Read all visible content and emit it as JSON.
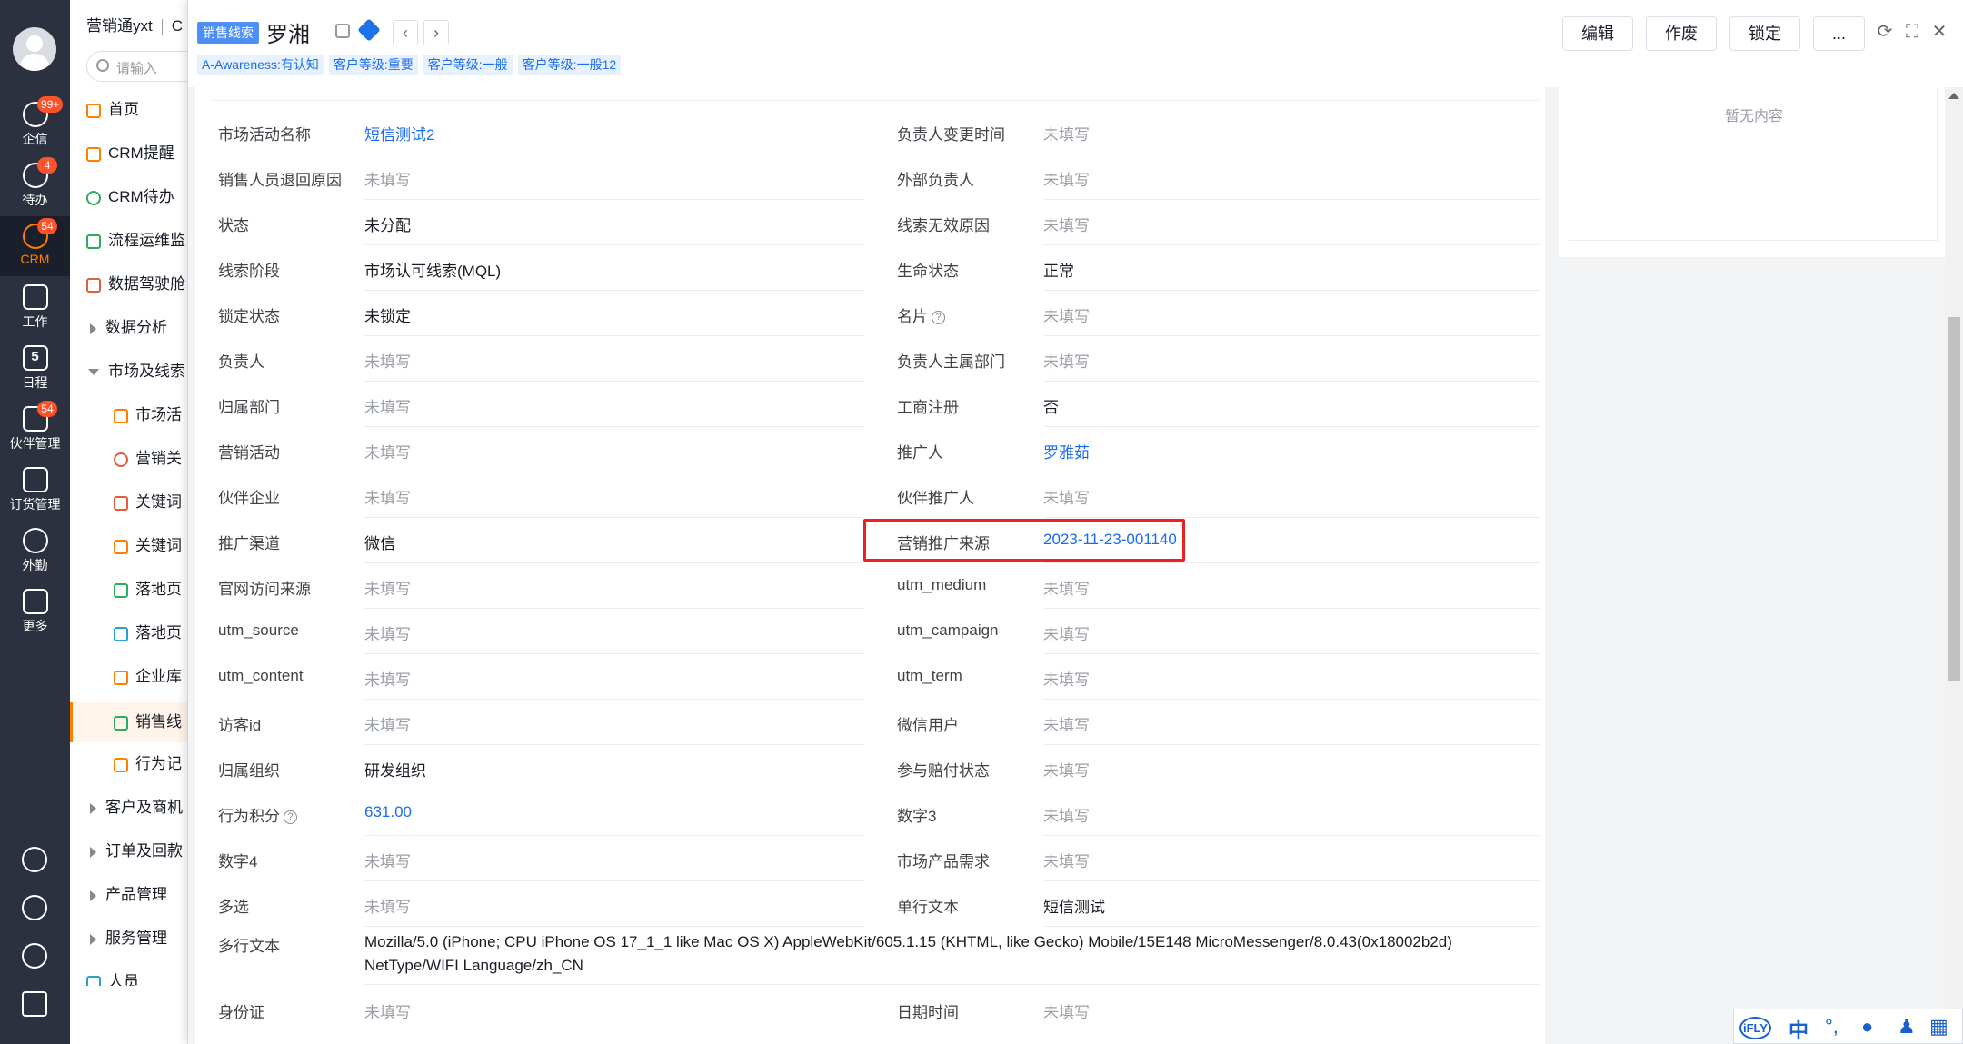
{
  "rail": {
    "items": [
      {
        "label": "企信",
        "badge": "99+",
        "icon": "chat-icon"
      },
      {
        "label": "待办",
        "badge": "4",
        "icon": "check-icon"
      },
      {
        "label": "CRM",
        "badge": "54",
        "icon": "crm-icon"
      },
      {
        "label": "工作",
        "badge": "",
        "icon": "briefcase-icon"
      },
      {
        "label": "日程",
        "badge": "",
        "icon": "calendar-icon",
        "glyph": "5"
      },
      {
        "label": "伙伴管理",
        "badge": "54",
        "icon": "partner-icon"
      },
      {
        "label": "订货管理",
        "badge": "",
        "icon": "order-icon"
      },
      {
        "label": "外勤",
        "badge": "",
        "icon": "location-icon"
      },
      {
        "label": "更多",
        "badge": "",
        "icon": "grid-icon"
      }
    ],
    "bottom_icons": [
      "help-icon",
      "clock-icon",
      "settings-icon",
      "user-list-icon"
    ]
  },
  "nav": {
    "app_name": "营销通yxt",
    "app_name_2": "C",
    "search_placeholder": "请输入",
    "items": [
      {
        "label": "首页"
      },
      {
        "label": "CRM提醒"
      },
      {
        "label": "CRM待办"
      },
      {
        "label": "流程运维监"
      },
      {
        "label": "数据驾驶舱"
      },
      {
        "label": "数据分析"
      },
      {
        "label": "市场及线索"
      },
      {
        "label": "市场活"
      },
      {
        "label": "营销关"
      },
      {
        "label": "关键词"
      },
      {
        "label": "关键词"
      },
      {
        "label": "落地页"
      },
      {
        "label": "落地页"
      },
      {
        "label": "企业库"
      },
      {
        "label": "销售线"
      },
      {
        "label": "行为记"
      },
      {
        "label": "客户及商机"
      },
      {
        "label": "订单及回款"
      },
      {
        "label": "产品管理"
      },
      {
        "label": "服务管理"
      },
      {
        "label": "人员"
      }
    ]
  },
  "header": {
    "object_tag": "销售线索",
    "title": "罗湘",
    "prev": "‹",
    "next": "›",
    "tags": [
      "A-Awareness:有认知",
      "客户等级:重要",
      "客户等级:一般",
      "客户等级:一般12"
    ],
    "actions": [
      "编辑",
      "作废",
      "锁定",
      "..."
    ],
    "icons": {
      "refresh": "⟳",
      "fullscreen": "⛶",
      "close": "✕"
    }
  },
  "fields": [
    [
      {
        "label": "市场活动名称",
        "value": "短信测试2",
        "type": "link"
      },
      {
        "label": "负责人变更时间",
        "value": "未填写",
        "type": "empty"
      }
    ],
    [
      {
        "label": "销售人员退回原因",
        "value": "未填写",
        "type": "empty"
      },
      {
        "label": "外部负责人",
        "value": "未填写",
        "type": "empty"
      }
    ],
    [
      {
        "label": "状态",
        "value": "未分配",
        "type": "plain"
      },
      {
        "label": "线索无效原因",
        "value": "未填写",
        "type": "empty"
      }
    ],
    [
      {
        "label": "线索阶段",
        "value": "市场认可线索(MQL)",
        "type": "plain"
      },
      {
        "label": "生命状态",
        "value": "正常",
        "type": "plain"
      }
    ],
    [
      {
        "label": "锁定状态",
        "value": "未锁定",
        "type": "plain"
      },
      {
        "label": "名片",
        "value": "未填写",
        "type": "empty",
        "help": "?"
      }
    ],
    [
      {
        "label": "负责人",
        "value": "未填写",
        "type": "empty"
      },
      {
        "label": "负责人主属部门",
        "value": "未填写",
        "type": "empty"
      }
    ],
    [
      {
        "label": "归属部门",
        "value": "未填写",
        "type": "empty"
      },
      {
        "label": "工商注册",
        "value": "否",
        "type": "plain"
      }
    ],
    [
      {
        "label": "营销活动",
        "value": "未填写",
        "type": "empty"
      },
      {
        "label": "推广人",
        "value": "罗雅茹",
        "type": "link"
      }
    ],
    [
      {
        "label": "伙伴企业",
        "value": "未填写",
        "type": "empty"
      },
      {
        "label": "伙伴推广人",
        "value": "未填写",
        "type": "empty"
      }
    ],
    [
      {
        "label": "推广渠道",
        "value": "微信",
        "type": "plain"
      },
      {
        "label": "营销推广来源",
        "value": "2023-11-23-001140",
        "type": "link",
        "highlight": true
      }
    ],
    [
      {
        "label": "官网访问来源",
        "value": "未填写",
        "type": "empty"
      },
      {
        "label": "utm_medium",
        "value": "未填写",
        "type": "empty"
      }
    ],
    [
      {
        "label": "utm_source",
        "value": "未填写",
        "type": "empty"
      },
      {
        "label": "utm_campaign",
        "value": "未填写",
        "type": "empty"
      }
    ],
    [
      {
        "label": "utm_content",
        "value": "未填写",
        "type": "empty"
      },
      {
        "label": "utm_term",
        "value": "未填写",
        "type": "empty"
      }
    ],
    [
      {
        "label": "访客id",
        "value": "未填写",
        "type": "empty"
      },
      {
        "label": "微信用户",
        "value": "未填写",
        "type": "empty"
      }
    ],
    [
      {
        "label": "归属组织",
        "value": "研发组织",
        "type": "plain"
      },
      {
        "label": "参与赔付状态",
        "value": "未填写",
        "type": "empty"
      }
    ],
    [
      {
        "label": "行为积分",
        "value": "631.00",
        "type": "link",
        "help": "?"
      },
      {
        "label": "数字3",
        "value": "未填写",
        "type": "empty"
      }
    ],
    [
      {
        "label": "数字4",
        "value": "未填写",
        "type": "empty"
      },
      {
        "label": "市场产品需求",
        "value": "未填写",
        "type": "empty"
      }
    ],
    [
      {
        "label": "多选",
        "value": "未填写",
        "type": "empty"
      },
      {
        "label": "单行文本",
        "value": "短信测试",
        "type": "plain"
      }
    ]
  ],
  "multiline": {
    "label": "多行文本",
    "line1": "Mozilla/5.0 (iPhone; CPU iPhone OS 17_1_1 like Mac OS X) AppleWebKit/605.1.15 (KHTML, like Gecko) Mobile/15E148 MicroMessenger/8.0.43(0x18002b2d)",
    "line2": "NetType/WIFI Language/zh_CN"
  },
  "last_row": [
    {
      "label": "身份证",
      "value": "未填写",
      "type": "empty"
    },
    {
      "label": "日期时间",
      "value": "未填写",
      "type": "empty"
    }
  ],
  "side": {
    "empty_text": "暂无内容"
  },
  "ime": {
    "logo": "iFLY",
    "lang": "中",
    "items": [
      "punct-icon",
      "mic-icon",
      "user-icon",
      "apps-icon"
    ]
  },
  "colors": {
    "accent": "#ff8000",
    "link": "#1a6df2",
    "highlight": "#f02020",
    "rail": "#2b313f"
  }
}
